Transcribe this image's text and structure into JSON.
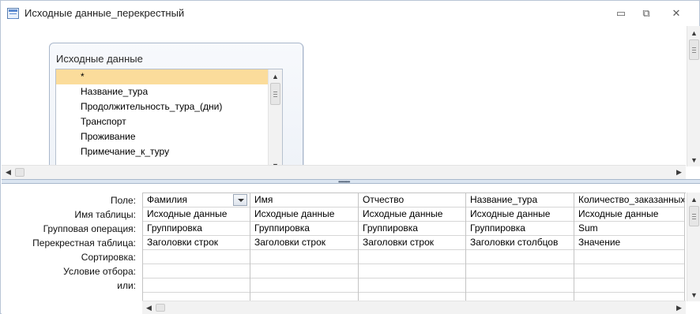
{
  "window": {
    "title": "Исходные данные_перекрестный",
    "minimize_glyph": "▭",
    "maximize_glyph": "⧉",
    "close_glyph": "✕"
  },
  "icons": {
    "window": "query-window-icon",
    "scroll_up": "scroll-up-arrow-icon",
    "scroll_down": "scroll-down-arrow-icon",
    "scroll_left": "scroll-left-arrow-icon",
    "scroll_right": "scroll-right-arrow-icon",
    "dropdown": "dropdown-arrow-icon"
  },
  "table_box": {
    "title": "Исходные данные",
    "fields": [
      {
        "label": "*",
        "selected": true
      },
      {
        "label": "Название_тура",
        "selected": false
      },
      {
        "label": "Продолжительность_тура_(дни)",
        "selected": false
      },
      {
        "label": "Транспорт",
        "selected": false
      },
      {
        "label": "Проживание",
        "selected": false
      },
      {
        "label": "Примечание_к_туру",
        "selected": false
      }
    ]
  },
  "splitter_grip": "••••••••",
  "grid": {
    "row_labels": [
      "Поле:",
      "Имя таблицы:",
      "Групповая операция:",
      "Перекрестная таблица:",
      "Сортировка:",
      "Условие отбора:",
      "или:"
    ],
    "columns": [
      {
        "field": "Фамилия",
        "table": "Исходные данные",
        "group": "Группировка",
        "crosstab": "Заголовки строк",
        "sort": "",
        "criteria": "",
        "or": ""
      },
      {
        "field": "Имя",
        "table": "Исходные данные",
        "group": "Группировка",
        "crosstab": "Заголовки строк",
        "sort": "",
        "criteria": "",
        "or": ""
      },
      {
        "field": "Отчество",
        "table": "Исходные данные",
        "group": "Группировка",
        "crosstab": "Заголовки строк",
        "sort": "",
        "criteria": "",
        "or": ""
      },
      {
        "field": "Название_тура",
        "table": "Исходные данные",
        "group": "Группировка",
        "crosstab": "Заголовки столбцов",
        "sort": "",
        "criteria": "",
        "or": ""
      },
      {
        "field": "Количество_заказанных",
        "table": "Исходные данные",
        "group": "Sum",
        "crosstab": "Значение",
        "sort": "",
        "criteria": "",
        "or": ""
      }
    ]
  },
  "colors": {
    "selected_row": "#fbdc9b",
    "splitter": "#dbe5f1",
    "table_border": "#a9b7cb"
  }
}
